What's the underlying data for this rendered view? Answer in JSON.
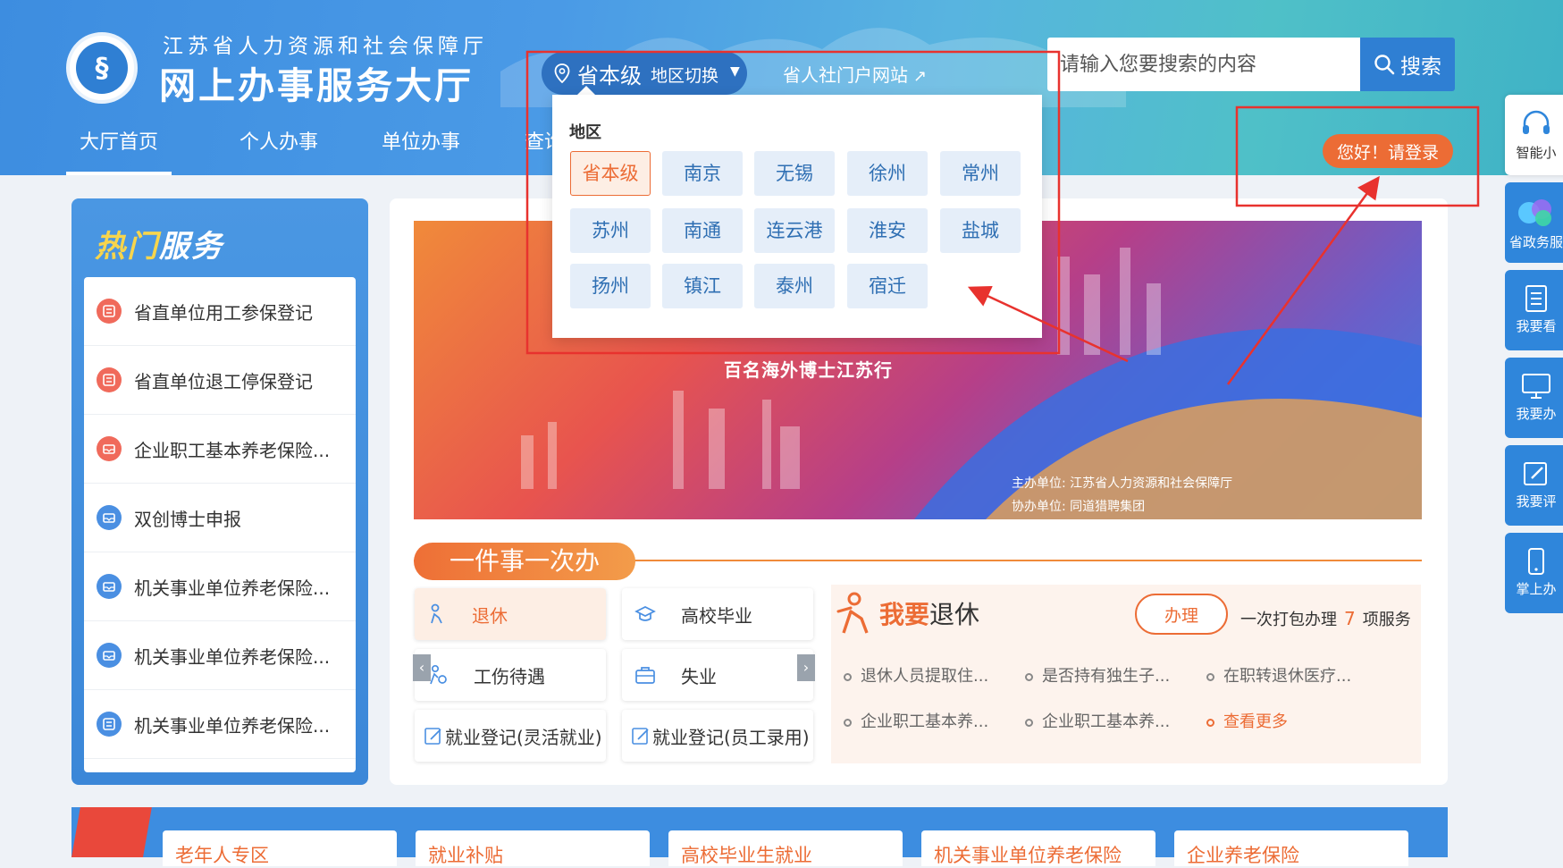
{
  "header": {
    "org_name": "江苏省人力资源和社会保障厅",
    "site_name": "网上办事服务大厅",
    "logo_char": "§",
    "region_current": "省本级",
    "region_switch": "地区切换",
    "portal_link": "省人社门户网站",
    "search_placeholder": "请输入您要搜索的内容",
    "search_button": "搜索",
    "login_button": "您好！请登录"
  },
  "nav": [
    {
      "label": "大厅首页",
      "active": true
    },
    {
      "label": "个人办事"
    },
    {
      "label": "单位办事"
    },
    {
      "label": "查询"
    }
  ],
  "float_bar": [
    {
      "label": "智能小",
      "icon": "headset-icon"
    },
    {
      "label": "省政务服",
      "icon": "app-logo-icon"
    },
    {
      "label": "我要看",
      "icon": "document-icon"
    },
    {
      "label": "我要办",
      "icon": "monitor-icon"
    },
    {
      "label": "我要评",
      "icon": "edit-icon"
    },
    {
      "label": "掌上办",
      "icon": "phone-icon"
    }
  ],
  "hot_services": {
    "title_part1": "热门",
    "title_part2": "服务",
    "items": [
      {
        "label": "省直单位用工参保登记",
        "color": "#f06a5b"
      },
      {
        "label": "省直单位退工停保登记",
        "color": "#f06a5b"
      },
      {
        "label": "企业职工基本养老保险...",
        "color": "#f06a5b"
      },
      {
        "label": "双创博士申报",
        "color": "#4a8fe2"
      },
      {
        "label": "机关事业单位养老保险...",
        "color": "#4a8fe2"
      },
      {
        "label": "机关事业单位养老保险...",
        "color": "#4a8fe2"
      },
      {
        "label": "机关事业单位养老保险...",
        "color": "#4a8fe2"
      }
    ]
  },
  "banner": {
    "subtitle": "百名海外博士江苏行",
    "host": "主办单位: 江苏省人力资源和社会保障厅",
    "co_host": "协办单位: 同道猎聘集团"
  },
  "one_thing": {
    "tag": "一件事一次办",
    "categories": [
      {
        "label": "退休",
        "active": true,
        "icon": "person-icon"
      },
      {
        "label": "高校毕业",
        "icon": "graduation-cap-icon"
      },
      {
        "label": "工伤待遇",
        "icon": "injury-icon"
      },
      {
        "label": "失业",
        "icon": "briefcase-icon"
      },
      {
        "label": "就业登记(灵活就业)",
        "icon": "form-icon"
      },
      {
        "label": "就业登记(员工录用)",
        "icon": "form-icon"
      }
    ],
    "retire": {
      "title_hl": "我要",
      "title_rest": "退休",
      "handle_button": "办理",
      "pack_text": "一次打包办理",
      "pack_count": "7",
      "pack_unit": "项服务",
      "links": [
        "退休人员提取住...",
        "是否持有独生子...",
        "在职转退休医疗...",
        "企业职工基本养...",
        "企业职工基本养..."
      ],
      "more": "查看更多"
    }
  },
  "bottom_cards": [
    "老年人专区",
    "就业补贴",
    "高校毕业生就业",
    "机关事业单位养老保险",
    "企业养老保险"
  ],
  "region_dropdown": {
    "title": "地区",
    "regions": [
      "省本级",
      "南京",
      "无锡",
      "徐州",
      "常州",
      "苏州",
      "南通",
      "连云港",
      "淮安",
      "盐城",
      "扬州",
      "镇江",
      "泰州",
      "宿迁"
    ],
    "selected": "省本级"
  },
  "colors": {
    "primary": "#2f7fd3",
    "accent": "#ec6c35",
    "annotation": "#e8322e"
  }
}
